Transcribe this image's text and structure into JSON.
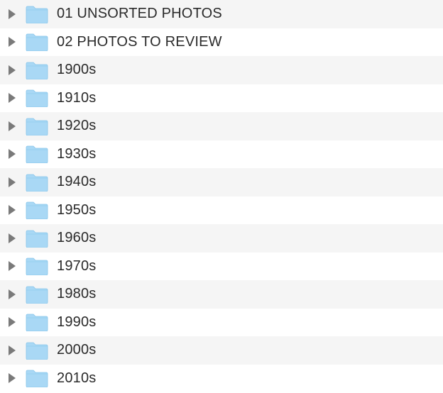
{
  "folders": [
    {
      "name": "01 UNSORTED PHOTOS"
    },
    {
      "name": "02 PHOTOS TO REVIEW"
    },
    {
      "name": "1900s"
    },
    {
      "name": "1910s"
    },
    {
      "name": "1920s"
    },
    {
      "name": "1930s"
    },
    {
      "name": "1940s"
    },
    {
      "name": "1950s"
    },
    {
      "name": "1960s"
    },
    {
      "name": "1970s"
    },
    {
      "name": "1980s"
    },
    {
      "name": "1990s"
    },
    {
      "name": "2000s"
    },
    {
      "name": "2010s"
    }
  ]
}
